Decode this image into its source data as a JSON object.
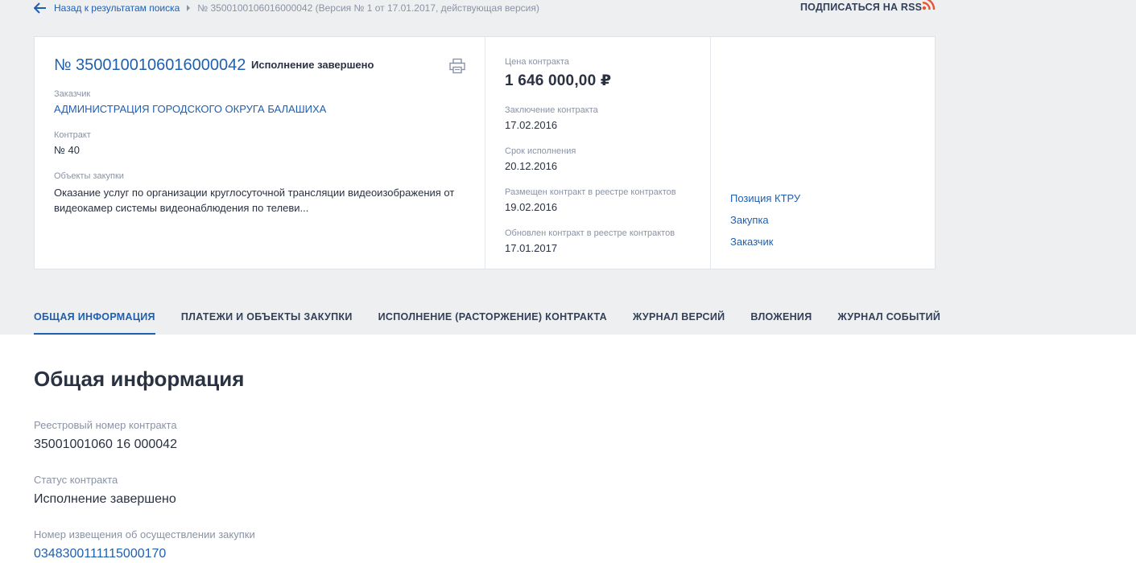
{
  "breadcrumb": {
    "back_label": "Назад к результатам поиска",
    "current": "№ 3500100106016000042 (Версия № 1 от 17.01.2017, действующая версия)"
  },
  "rss": {
    "label": "ПОДПИСАТЬСЯ НА RSS",
    "icon": "rss-icon"
  },
  "card": {
    "number": "№ 3500100106016000042",
    "status": "Исполнение завершено",
    "customer_label": "Заказчик",
    "customer_value": "АДМИНИСТРАЦИЯ ГОРОДСКОГО ОКРУГА БАЛАШИХА",
    "contract_label": "Контракт",
    "contract_value": "№ 40",
    "objects_label": "Объекты закупки",
    "objects_value": "Оказание услуг по организации круглосуточной трансляции видеоизображения от видеокамер системы видеонаблюдения по телеви...",
    "price_label": "Цена контракта",
    "price_value": "1 646 000,00 ₽",
    "conclusion_label": "Заключение контракта",
    "conclusion_value": "17.02.2016",
    "term_label": "Срок исполнения",
    "term_value": "20.12.2016",
    "placed_label": "Размещен контракт в реестре контрактов",
    "placed_value": "19.02.2016",
    "updated_label": "Обновлен контракт в реестре контрактов",
    "updated_value": "17.01.2017",
    "links": [
      "Позиция КТРУ",
      "Закупка",
      "Заказчик"
    ]
  },
  "tabs": [
    {
      "label": "ОБЩАЯ ИНФОРМАЦИЯ",
      "active": true
    },
    {
      "label": "ПЛАТЕЖИ И ОБЪЕКТЫ ЗАКУПКИ",
      "active": false
    },
    {
      "label": "ИСПОЛНЕНИЕ (РАСТОРЖЕНИЕ) КОНТРАКТА",
      "active": false
    },
    {
      "label": "ЖУРНАЛ ВЕРСИЙ",
      "active": false
    },
    {
      "label": "ВЛОЖЕНИЯ",
      "active": false
    },
    {
      "label": "ЖУРНАЛ СОБЫТИЙ",
      "active": false
    }
  ],
  "main": {
    "title": "Общая информация",
    "fields": [
      {
        "label": "Реестровый номер контракта",
        "value": "35001001060 16 000042"
      },
      {
        "label": "Статус контракта",
        "value": "Исполнение завершено"
      },
      {
        "label": "Номер извещения об осуществлении закупки",
        "value": "0348300111115000170"
      }
    ]
  },
  "colors": {
    "accent": "#1f5fb0",
    "rss": "#e8542e",
    "background": "#eeeff1"
  }
}
